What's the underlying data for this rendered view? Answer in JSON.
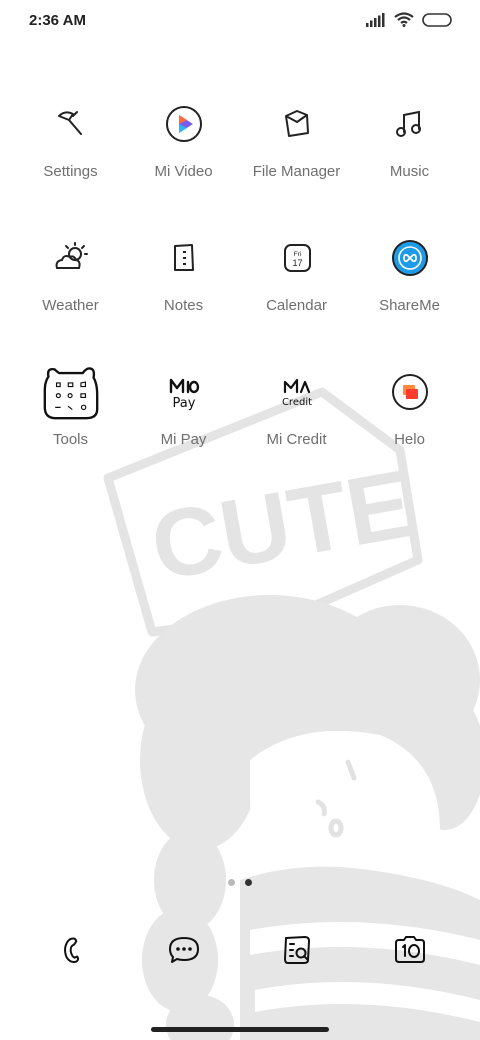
{
  "status_bar": {
    "time": "2:36 AM",
    "icons": [
      "signal-icon",
      "wifi-icon",
      "battery-icon"
    ]
  },
  "wallpaper": {
    "text": "CUTE"
  },
  "apps": [
    {
      "label": "Settings",
      "icon": "settings-icon"
    },
    {
      "label": "Mi Video",
      "icon": "mi-video-icon"
    },
    {
      "label": "File Manager",
      "icon": "file-manager-icon"
    },
    {
      "label": "Music",
      "icon": "music-icon"
    },
    {
      "label": "Weather",
      "icon": "weather-icon"
    },
    {
      "label": "Notes",
      "icon": "notes-icon"
    },
    {
      "label": "Calendar",
      "icon": "calendar-icon",
      "icon_text": [
        "Fri",
        "17"
      ]
    },
    {
      "label": "ShareMe",
      "icon": "shareme-icon"
    },
    {
      "label": "Tools",
      "icon": "tools-folder-icon"
    },
    {
      "label": "Mi Pay",
      "icon": "mi-pay-icon",
      "icon_text": "Pay"
    },
    {
      "label": "Mi Credit",
      "icon": "mi-credit-icon",
      "icon_text": "Credit"
    },
    {
      "label": "Helo",
      "icon": "helo-icon"
    }
  ],
  "page_indicator": {
    "pages": 2,
    "current": 2
  },
  "dock": [
    {
      "icon": "phone-icon"
    },
    {
      "icon": "messages-icon"
    },
    {
      "icon": "browser-icon"
    },
    {
      "icon": "camera-icon"
    }
  ],
  "colors": {
    "label": "#6f6f6f",
    "wallpaper_gray": "#e6e6e6",
    "shareme_blue": "#1e9be8",
    "helo_orange": "#ff5a1f"
  }
}
